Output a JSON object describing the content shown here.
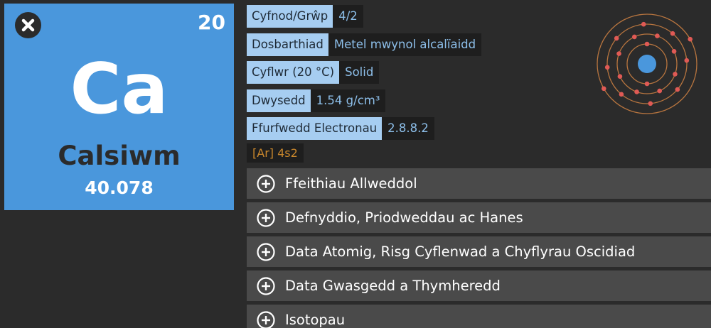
{
  "element": {
    "atomic_number": "20",
    "symbol": "Ca",
    "name": "Calsiwm",
    "atomic_mass": "40.078"
  },
  "properties": [
    {
      "label": "Cyfnod/Grŵp",
      "value": "4/2"
    },
    {
      "label": "Dosbarthiad",
      "value": "Metel mwynol alcalïaidd"
    },
    {
      "label": "Cyflwr (20 °C)",
      "value": "Solid"
    },
    {
      "label": "Dwysedd",
      "value": "1.54  g/cm³"
    },
    {
      "label": "Ffurfwedd Electronau",
      "value": "2.8.8.2"
    }
  ],
  "electron_config_short": "[Ar] 4s2",
  "sections": [
    {
      "title": "Ffeithiau Allweddol"
    },
    {
      "title": "Defnyddio, Priodweddau ac Hanes"
    },
    {
      "title": "Data Atomig, Risg Cyflenwad a Chyflyrau Oscidiad"
    },
    {
      "title": "Data Gwasgedd a Thymheredd"
    },
    {
      "title": "Isotopau"
    }
  ],
  "colors": {
    "tile": "#4a97dc",
    "label_bg": "#a6cdf1",
    "value_text": "#8dbfea",
    "config_text": "#c9872c",
    "shell": "#b8753f",
    "electron": "#e05a55"
  },
  "icons": {
    "close": "close-icon",
    "expand": "plus-circle-icon",
    "atom": "bohr-model-icon"
  }
}
